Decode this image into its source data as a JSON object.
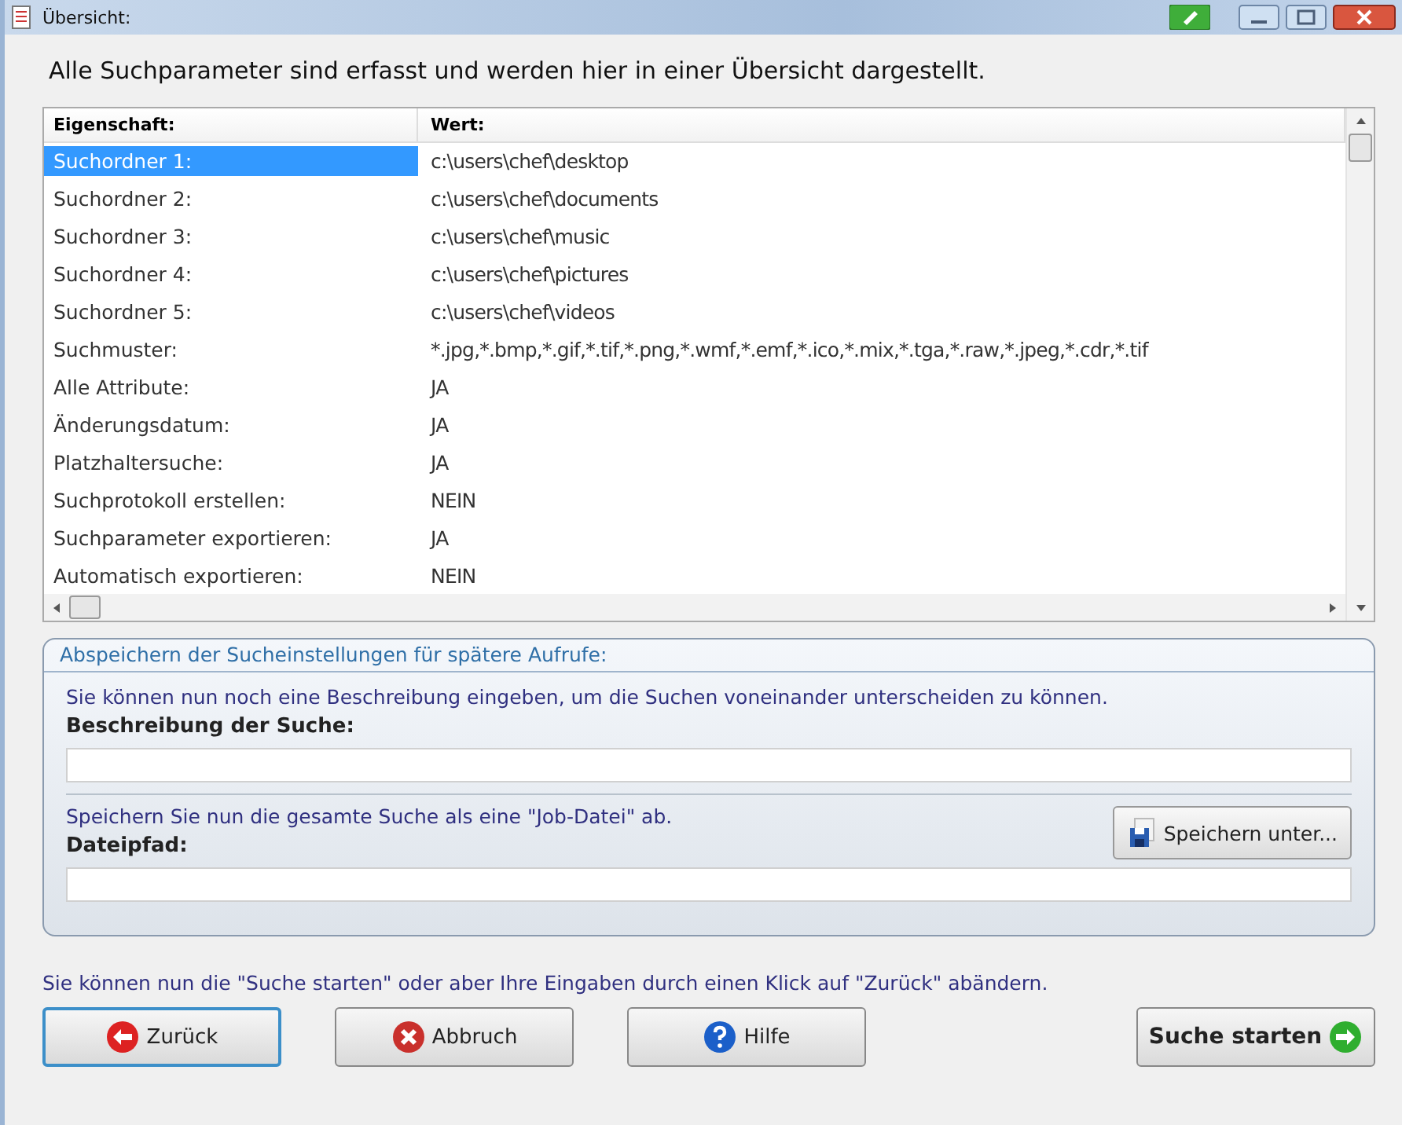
{
  "window": {
    "title": "Übersicht:"
  },
  "heading": "Alle Suchparameter sind erfasst und werden hier in einer Übersicht dargestellt.",
  "table": {
    "columns": [
      "Eigenschaft:",
      "Wert:"
    ],
    "rows": [
      {
        "property": "Suchordner 1:",
        "value": "c:\\users\\chef\\desktop",
        "selected": true
      },
      {
        "property": "Suchordner 2:",
        "value": "c:\\users\\chef\\documents",
        "selected": false
      },
      {
        "property": "Suchordner 3:",
        "value": "c:\\users\\chef\\music",
        "selected": false
      },
      {
        "property": "Suchordner 4:",
        "value": "c:\\users\\chef\\pictures",
        "selected": false
      },
      {
        "property": "Suchordner 5:",
        "value": "c:\\users\\chef\\videos",
        "selected": false
      },
      {
        "property": "Suchmuster:",
        "value": "*.jpg,*.bmp,*.gif,*.tif,*.png,*.wmf,*.emf,*.ico,*.mix,*.tga,*.raw,*.jpeg,*.cdr,*.tif",
        "selected": false
      },
      {
        "property": "Alle Attribute:",
        "value": "JA",
        "selected": false
      },
      {
        "property": "Änderungsdatum:",
        "value": "JA",
        "selected": false
      },
      {
        "property": "Platzhaltersuche:",
        "value": "JA",
        "selected": false
      },
      {
        "property": "Suchprotokoll erstellen:",
        "value": "NEIN",
        "selected": false
      },
      {
        "property": "Suchparameter exportieren:",
        "value": "JA",
        "selected": false
      },
      {
        "property": "Automatisch exportieren:",
        "value": "NEIN",
        "selected": false
      }
    ]
  },
  "save_group": {
    "title": "Abspeichern der Sucheinstellungen für spätere Aufrufe:",
    "hint": "Sie können nun noch eine Beschreibung eingeben, um die Suchen voneinander unterscheiden zu können.",
    "description_label": "Beschreibung der Suche:",
    "job_hint": "Speichern Sie nun die gesamte Suche als eine \"Job-Datei\" ab.",
    "save_button": "Speichern unter...",
    "path_label": "Dateipfad:"
  },
  "footer_hint": "Sie können nun die \"Suche starten\" oder aber Ihre Eingaben durch einen Klick auf  \"Zurück\" abändern.",
  "buttons": [
    {
      "kind": "back",
      "label": "Zurück",
      "selected": true
    },
    {
      "kind": "cancel",
      "label": "Abbruch",
      "selected": false
    },
    {
      "kind": "help",
      "label": "Hilfe",
      "selected": false
    },
    {
      "kind": "start",
      "label": "Suche starten",
      "selected": false
    }
  ]
}
